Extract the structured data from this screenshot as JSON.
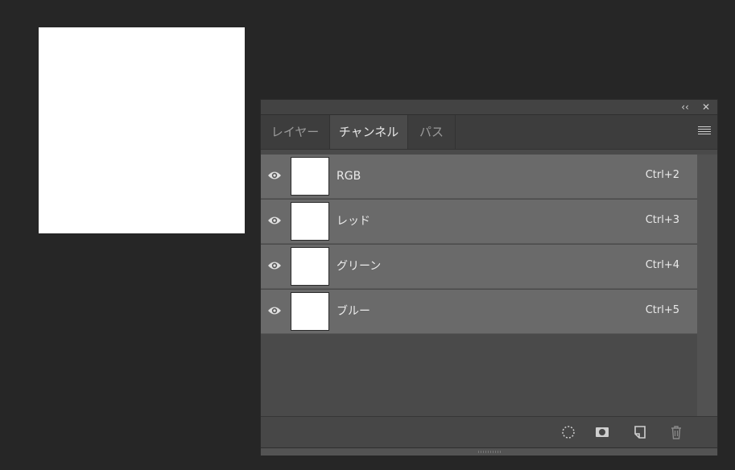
{
  "panel": {
    "collapse_icon": "‹‹",
    "close_icon": "✕",
    "tabs": [
      {
        "label": "レイヤー",
        "active": false
      },
      {
        "label": "チャンネル",
        "active": true
      },
      {
        "label": "パス",
        "active": false
      }
    ],
    "menu_icon": "hamburger-menu-icon"
  },
  "channels": [
    {
      "name": "RGB",
      "shortcut": "Ctrl+2"
    },
    {
      "name": "レッド",
      "shortcut": "Ctrl+3"
    },
    {
      "name": "グリーン",
      "shortcut": "Ctrl+4"
    },
    {
      "name": "ブルー",
      "shortcut": "Ctrl+5"
    }
  ],
  "footer": {
    "icons": [
      "load-selection-icon",
      "save-selection-icon",
      "new-channel-icon",
      "delete-channel-icon"
    ]
  },
  "colors": {
    "background": "#262626",
    "panel": "#4a4a4a",
    "row": "#6a6a6a",
    "document": "#ffffff"
  }
}
